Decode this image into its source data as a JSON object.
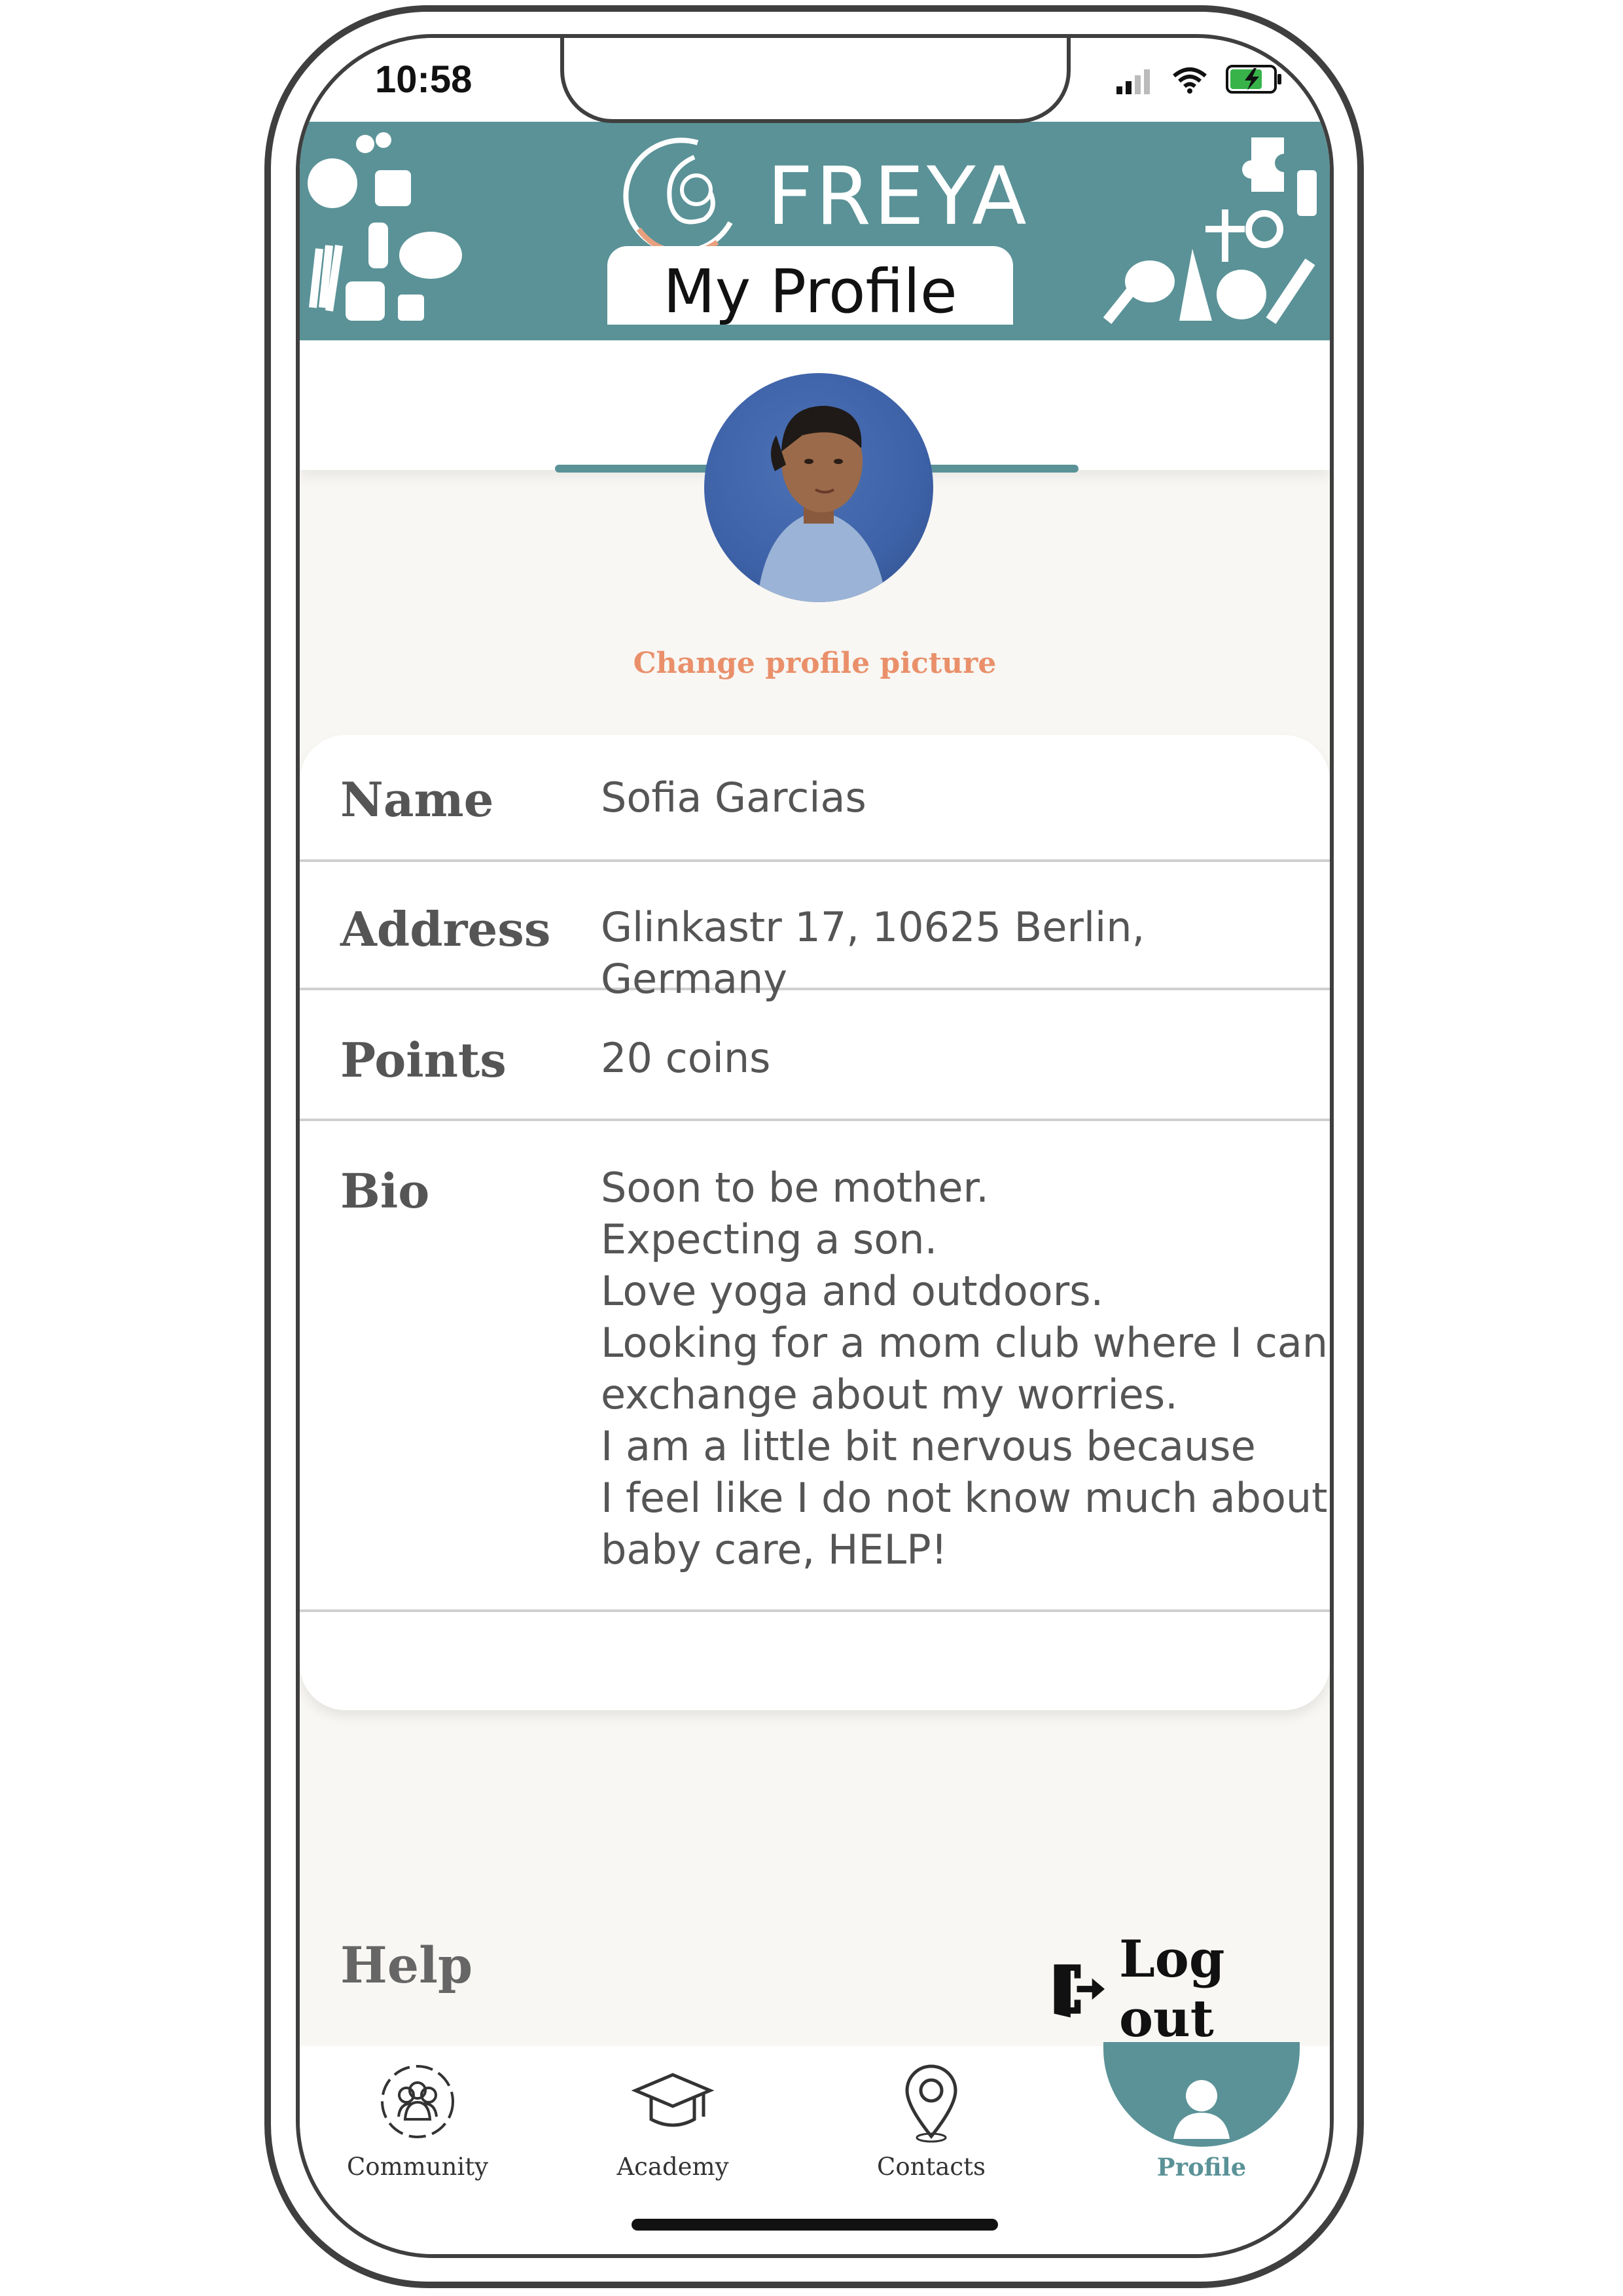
{
  "status_bar": {
    "time": "10:58"
  },
  "header": {
    "brand": "FREYA",
    "page_title": "My Profile"
  },
  "profile": {
    "change_picture_label": "Change profile picture",
    "fields": {
      "name": {
        "label": "Name",
        "value": "Sofia Garcias"
      },
      "address": {
        "label": "Address",
        "value": "Glinkastr 17, 10625 Berlin, Germany"
      },
      "points": {
        "label": "Points",
        "value": "20 coins"
      },
      "bio": {
        "label": "Bio",
        "lines": [
          "Soon to be mother.",
          "Expecting a son.",
          "Love yoga and outdoors.",
          "Looking for a mom club where I can",
          "exchange about my worries.",
          "I am a little bit nervous because",
          "I feel like I do not know much about",
          "baby care, HELP!"
        ]
      }
    }
  },
  "footer_links": {
    "help": "Help",
    "logout": "Log out"
  },
  "tabbar": {
    "tabs": [
      {
        "label": "Community",
        "icon": "community-icon"
      },
      {
        "label": "Academy",
        "icon": "graduation-cap-icon"
      },
      {
        "label": "Contacts",
        "icon": "location-pin-icon"
      },
      {
        "label": "Profile",
        "icon": "person-icon",
        "active": true
      }
    ]
  },
  "colors": {
    "brand_teal": "#5a9297",
    "accent_orange": "#e9906b",
    "background": "#f8f7f3"
  }
}
